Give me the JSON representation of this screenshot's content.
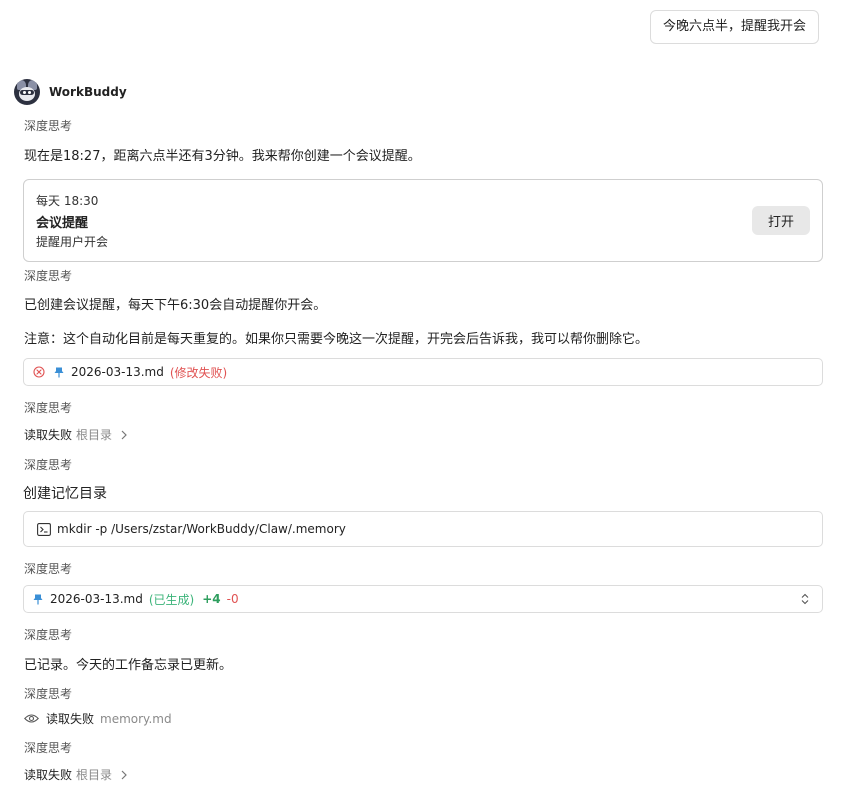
{
  "user_message": "今晚六点半，提醒我开会",
  "bot": {
    "name": "WorkBuddy"
  },
  "thinking_label": "深度思考",
  "messages": {
    "m1": "现在是18:27，距离六点半还有3分钟。我来帮你创建一个会议提醒。",
    "m2": "已创建会议提醒，每天下午6:30会自动提醒你开会。",
    "m3": "注意：这个自动化目前是每天重复的。如果你只需要今晚这一次提醒，开完会后告诉我，我可以帮你删除它。",
    "m4": "已记录。今天的工作备忘录已更新。"
  },
  "reminder_card": {
    "schedule": "每天 18:30",
    "title": "会议提醒",
    "description": "提醒用户开会",
    "open_label": "打开"
  },
  "file_failed": {
    "filename": "2026-03-13.md",
    "status": "(修改失败)"
  },
  "read_fail_1": {
    "label": "读取失败",
    "target": "根目录"
  },
  "create_dir": {
    "title": "创建记忆目录",
    "command": "mkdir -p /Users/zstar/WorkBuddy/Claw/.memory"
  },
  "file_generated": {
    "filename": "2026-03-13.md",
    "status": "(已生成)",
    "added": "+4",
    "removed": "-0"
  },
  "read_fail_2": {
    "label": "读取失败",
    "target": "memory.md"
  },
  "read_fail_3": {
    "label": "读取失败",
    "target": "根目录"
  },
  "colors": {
    "error": "#e05252",
    "success": "#3cb47a",
    "added": "#2e9e5e",
    "pin": "#3a8fd6"
  }
}
